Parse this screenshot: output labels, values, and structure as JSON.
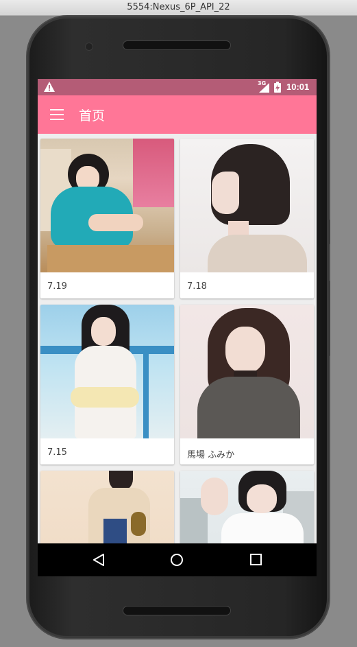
{
  "window": {
    "title": "5554:Nexus_6P_API_22"
  },
  "status_bar": {
    "warning_icon": "warning-triangle-icon",
    "network": "3G",
    "time": "10:01"
  },
  "app_bar": {
    "menu_icon": "hamburger-menu-icon",
    "title": "首页"
  },
  "grid": {
    "cards": [
      {
        "caption": "7.19"
      },
      {
        "caption": "7.18"
      },
      {
        "caption": "7.15"
      },
      {
        "caption": "馬場 ふみか"
      },
      {
        "caption": ""
      },
      {
        "caption": ""
      }
    ]
  },
  "nav_bar": {
    "icons": [
      "back-icon",
      "home-icon",
      "recents-icon"
    ]
  },
  "colors": {
    "status_bar": "#b45c76",
    "app_bar": "#ff7697",
    "content_bg": "#eeeeee"
  }
}
